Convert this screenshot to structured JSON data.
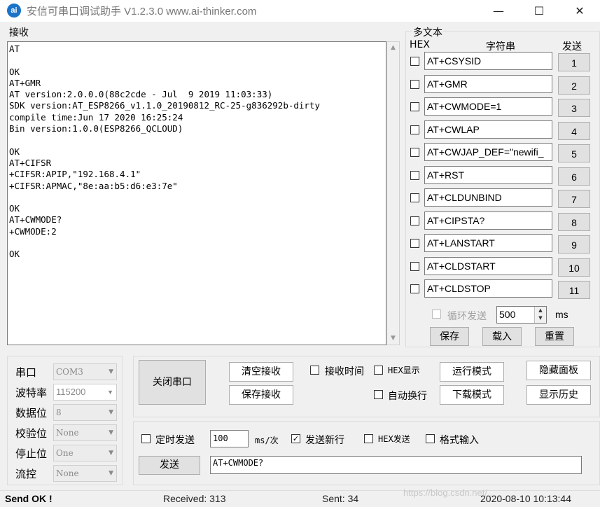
{
  "window": {
    "title": "安信可串口调试助手 V1.2.3.0    www.ai-thinker.com",
    "icon_text": "ai",
    "minimize_glyph": "—",
    "maximize_glyph": "☐",
    "close_glyph": "✕"
  },
  "receive": {
    "label": "接收",
    "text": "AT\n\nOK\nAT+GMR\nAT version:2.0.0.0(88c2cde - Jul  9 2019 11:03:33)\nSDK version:AT_ESP8266_v1.1.0_20190812_RC-25-g836292b-dirty\ncompile time:Jun 17 2020 16:25:24\nBin version:1.0.0(ESP8266_QCLOUD)\n\nOK\nAT+CIFSR\n+CIFSR:APIP,\"192.168.4.1\"\n+CIFSR:APMAC,\"8e:aa:b5:d6:e3:7e\"\n\nOK\nAT+CWMODE?\n+CWMODE:2\n\nOK"
  },
  "multi_text": {
    "title": "多文本",
    "col_hex": "HEX",
    "col_string": "字符串",
    "col_send": "发送",
    "rows": [
      {
        "text": "AT+CSYSID",
        "num": "1"
      },
      {
        "text": "AT+GMR",
        "num": "2"
      },
      {
        "text": "AT+CWMODE=1",
        "num": "3"
      },
      {
        "text": "AT+CWLAP",
        "num": "4"
      },
      {
        "text": "AT+CWJAP_DEF=\"newifi_",
        "num": "5"
      },
      {
        "text": "AT+RST",
        "num": "6"
      },
      {
        "text": "AT+CLDUNBIND",
        "num": "7"
      },
      {
        "text": "AT+CIPSTA?",
        "num": "8"
      },
      {
        "text": "AT+LANSTART",
        "num": "9"
      },
      {
        "text": "AT+CLDSTART",
        "num": "10"
      },
      {
        "text": "AT+CLDSTOP",
        "num": "11"
      }
    ],
    "loop_label": "循环发送",
    "loop_value": "500",
    "loop_unit": "ms",
    "save_label": "保存",
    "load_label": "载入",
    "reset_label": "重置"
  },
  "serial": {
    "port_label": "串口",
    "port_value": "COM3",
    "baud_label": "波特率",
    "baud_value": "115200",
    "databits_label": "数据位",
    "databits_value": "8",
    "parity_label": "校验位",
    "parity_value": "None",
    "stopbits_label": "停止位",
    "stopbits_value": "One",
    "flow_label": "流控",
    "flow_value": "None"
  },
  "controls": {
    "close_port": "关闭串口",
    "clear_receive": "清空接收",
    "save_receive": "保存接收",
    "receive_time": "接收时间",
    "hex_display": "HEX显示",
    "auto_wrap": "自动换行",
    "run_mode": "运行模式",
    "download_mode": "下载模式",
    "hide_panel": "隐藏面板",
    "show_history": "显示历史"
  },
  "send": {
    "timed_send": "定时发送",
    "interval_value": "100",
    "interval_unit": "ms/次",
    "send_newline": "发送新行",
    "hex_send": "HEX发送",
    "format_input": "格式输入",
    "send_button": "发送",
    "input_value": "AT+CWMODE?"
  },
  "status": {
    "message": "Send OK !",
    "received": "Received: 313",
    "sent": "Sent: 34",
    "datetime": "2020-08-10 10:13:44",
    "watermark": "https://blog.csdn.net/..."
  },
  "colors": {
    "accent": "#1a73c7",
    "window_bg": "#f0f0f0",
    "button_bg": "#e1e1e1"
  }
}
